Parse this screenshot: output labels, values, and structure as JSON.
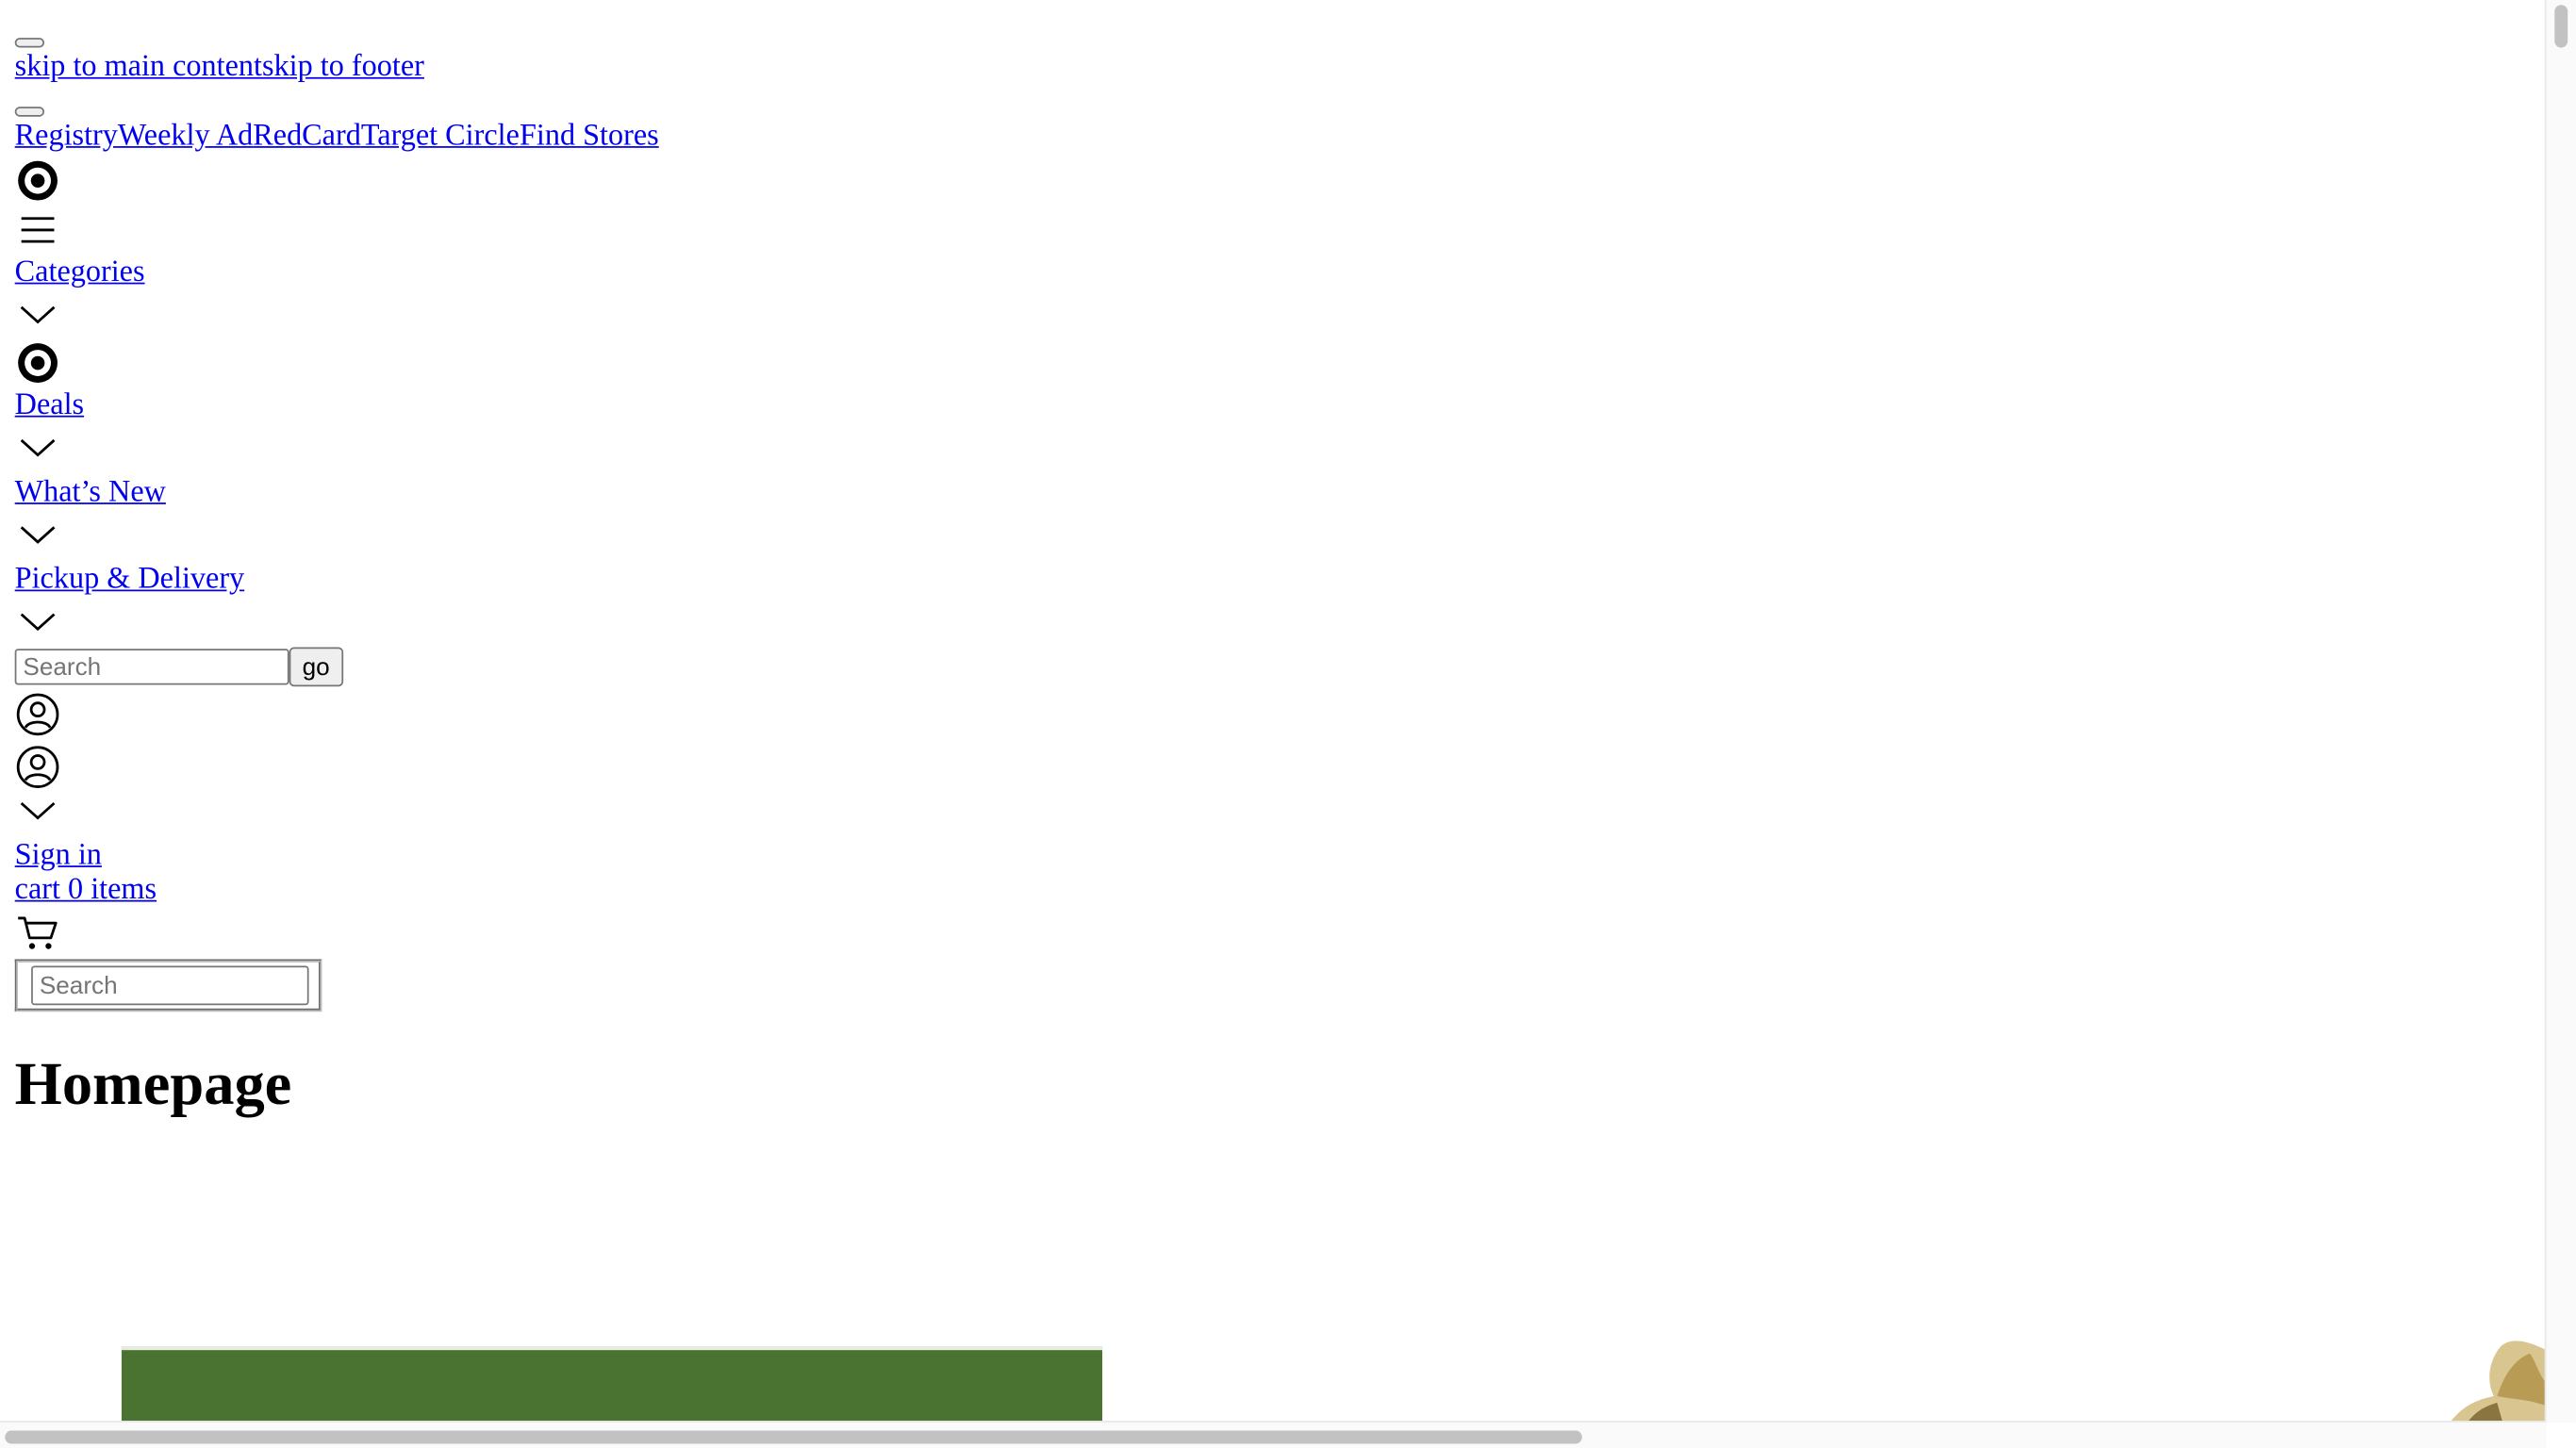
{
  "skip_links": {
    "main": "skip to main content",
    "footer": "skip to footer"
  },
  "utility_nav": [
    {
      "label": "Registry"
    },
    {
      "label": "Weekly Ad"
    },
    {
      "label": "RedCard"
    },
    {
      "label": "Target Circle"
    },
    {
      "label": "Find Stores"
    }
  ],
  "main_nav": {
    "categories": "Categories",
    "deals": "Deals",
    "whats_new": "What’s New",
    "pickup_delivery": "Pickup & Delivery"
  },
  "search": {
    "placeholder": "Search",
    "button_label": "go"
  },
  "account": {
    "sign_in": "Sign in"
  },
  "cart": {
    "label": "cart 0 items"
  },
  "secondary_search": {
    "placeholder": "Search"
  },
  "page": {
    "heading": "Homepage"
  },
  "icons": {
    "logo": "target-logo-icon",
    "menu": "hamburger-menu-icon",
    "chevron": "chevron-down-icon",
    "account": "account-icon",
    "cart": "cart-icon"
  },
  "colors": {
    "link": "#0000ee",
    "hero_green": "#4a7331"
  }
}
